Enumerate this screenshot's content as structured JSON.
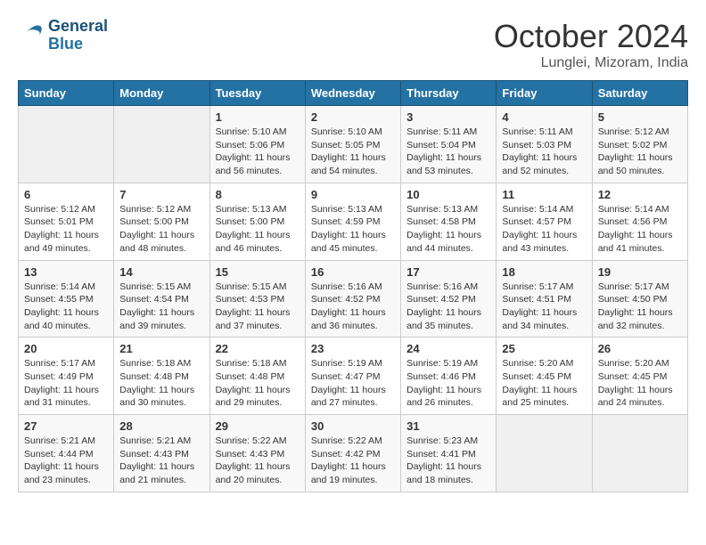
{
  "logo": {
    "line1": "General",
    "line2": "Blue"
  },
  "title": "October 2024",
  "subtitle": "Lunglei, Mizoram, India",
  "days_of_week": [
    "Sunday",
    "Monday",
    "Tuesday",
    "Wednesday",
    "Thursday",
    "Friday",
    "Saturday"
  ],
  "weeks": [
    [
      {
        "num": "",
        "empty": true
      },
      {
        "num": "",
        "empty": true
      },
      {
        "num": "1",
        "sunrise": "5:10 AM",
        "sunset": "5:06 PM",
        "daylight": "11 hours and 56 minutes."
      },
      {
        "num": "2",
        "sunrise": "5:10 AM",
        "sunset": "5:05 PM",
        "daylight": "11 hours and 54 minutes."
      },
      {
        "num": "3",
        "sunrise": "5:11 AM",
        "sunset": "5:04 PM",
        "daylight": "11 hours and 53 minutes."
      },
      {
        "num": "4",
        "sunrise": "5:11 AM",
        "sunset": "5:03 PM",
        "daylight": "11 hours and 52 minutes."
      },
      {
        "num": "5",
        "sunrise": "5:12 AM",
        "sunset": "5:02 PM",
        "daylight": "11 hours and 50 minutes."
      }
    ],
    [
      {
        "num": "6",
        "sunrise": "5:12 AM",
        "sunset": "5:01 PM",
        "daylight": "11 hours and 49 minutes."
      },
      {
        "num": "7",
        "sunrise": "5:12 AM",
        "sunset": "5:00 PM",
        "daylight": "11 hours and 48 minutes."
      },
      {
        "num": "8",
        "sunrise": "5:13 AM",
        "sunset": "5:00 PM",
        "daylight": "11 hours and 46 minutes."
      },
      {
        "num": "9",
        "sunrise": "5:13 AM",
        "sunset": "4:59 PM",
        "daylight": "11 hours and 45 minutes."
      },
      {
        "num": "10",
        "sunrise": "5:13 AM",
        "sunset": "4:58 PM",
        "daylight": "11 hours and 44 minutes."
      },
      {
        "num": "11",
        "sunrise": "5:14 AM",
        "sunset": "4:57 PM",
        "daylight": "11 hours and 43 minutes."
      },
      {
        "num": "12",
        "sunrise": "5:14 AM",
        "sunset": "4:56 PM",
        "daylight": "11 hours and 41 minutes."
      }
    ],
    [
      {
        "num": "13",
        "sunrise": "5:14 AM",
        "sunset": "4:55 PM",
        "daylight": "11 hours and 40 minutes."
      },
      {
        "num": "14",
        "sunrise": "5:15 AM",
        "sunset": "4:54 PM",
        "daylight": "11 hours and 39 minutes."
      },
      {
        "num": "15",
        "sunrise": "5:15 AM",
        "sunset": "4:53 PM",
        "daylight": "11 hours and 37 minutes."
      },
      {
        "num": "16",
        "sunrise": "5:16 AM",
        "sunset": "4:52 PM",
        "daylight": "11 hours and 36 minutes."
      },
      {
        "num": "17",
        "sunrise": "5:16 AM",
        "sunset": "4:52 PM",
        "daylight": "11 hours and 35 minutes."
      },
      {
        "num": "18",
        "sunrise": "5:17 AM",
        "sunset": "4:51 PM",
        "daylight": "11 hours and 34 minutes."
      },
      {
        "num": "19",
        "sunrise": "5:17 AM",
        "sunset": "4:50 PM",
        "daylight": "11 hours and 32 minutes."
      }
    ],
    [
      {
        "num": "20",
        "sunrise": "5:17 AM",
        "sunset": "4:49 PM",
        "daylight": "11 hours and 31 minutes."
      },
      {
        "num": "21",
        "sunrise": "5:18 AM",
        "sunset": "4:48 PM",
        "daylight": "11 hours and 30 minutes."
      },
      {
        "num": "22",
        "sunrise": "5:18 AM",
        "sunset": "4:48 PM",
        "daylight": "11 hours and 29 minutes."
      },
      {
        "num": "23",
        "sunrise": "5:19 AM",
        "sunset": "4:47 PM",
        "daylight": "11 hours and 27 minutes."
      },
      {
        "num": "24",
        "sunrise": "5:19 AM",
        "sunset": "4:46 PM",
        "daylight": "11 hours and 26 minutes."
      },
      {
        "num": "25",
        "sunrise": "5:20 AM",
        "sunset": "4:45 PM",
        "daylight": "11 hours and 25 minutes."
      },
      {
        "num": "26",
        "sunrise": "5:20 AM",
        "sunset": "4:45 PM",
        "daylight": "11 hours and 24 minutes."
      }
    ],
    [
      {
        "num": "27",
        "sunrise": "5:21 AM",
        "sunset": "4:44 PM",
        "daylight": "11 hours and 23 minutes."
      },
      {
        "num": "28",
        "sunrise": "5:21 AM",
        "sunset": "4:43 PM",
        "daylight": "11 hours and 21 minutes."
      },
      {
        "num": "29",
        "sunrise": "5:22 AM",
        "sunset": "4:43 PM",
        "daylight": "11 hours and 20 minutes."
      },
      {
        "num": "30",
        "sunrise": "5:22 AM",
        "sunset": "4:42 PM",
        "daylight": "11 hours and 19 minutes."
      },
      {
        "num": "31",
        "sunrise": "5:23 AM",
        "sunset": "4:41 PM",
        "daylight": "11 hours and 18 minutes."
      },
      {
        "num": "",
        "empty": true
      },
      {
        "num": "",
        "empty": true
      }
    ]
  ],
  "sunrise_label": "Sunrise:",
  "sunset_label": "Sunset:",
  "daylight_label": "Daylight:"
}
